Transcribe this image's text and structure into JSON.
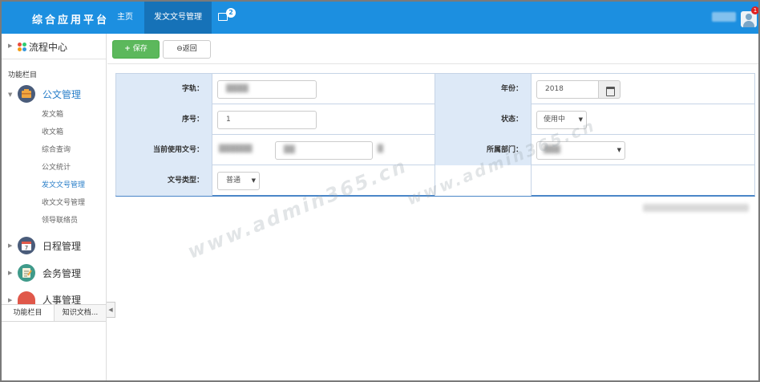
{
  "header": {
    "brand": "综合应用平台",
    "nav": {
      "home": "主页",
      "active_tab": "发文文号管理"
    },
    "message_count": "2",
    "notification_count": "1"
  },
  "sidebar": {
    "top_label": "流程中心",
    "section_title": "功能栏目",
    "groups": [
      {
        "label": "公文管理",
        "icon": "document-mgmt-icon"
      },
      {
        "label": "日程管理",
        "icon": "calendar-icon"
      },
      {
        "label": "会务管理",
        "icon": "meeting-icon"
      },
      {
        "label": "人事管理",
        "icon": "hr-icon"
      }
    ],
    "sub_items": [
      "发文箱",
      "收文箱",
      "综合查询",
      "公文统计",
      "发文文号管理",
      "收文文号管理",
      "领导联络员"
    ],
    "active_sub_index": 4,
    "tabs": [
      "功能栏目",
      "知识文档..."
    ],
    "calendar_day": "7"
  },
  "toolbar": {
    "save_label": "保存",
    "back_label": "返回",
    "save_icon": "+",
    "back_icon": "⊖"
  },
  "form": {
    "zigui_label": "字轨：",
    "year_label": "年份：",
    "year_value": "2018",
    "seq_label": "序号：",
    "seq_value": "1",
    "status_label": "状态：",
    "status_value": "使用中",
    "current_no_label": "当前使用文号：",
    "department_label": "所属部门：",
    "doctype_label": "文号类型：",
    "doctype_value": "普通"
  },
  "watermark": "www.admin365.cn",
  "colors": {
    "topbar": "#1c8fe0",
    "topbar_active": "#1672b8",
    "save_button": "#5cb85c",
    "label_bg": "#dde9f7",
    "active_link": "#2a7fc9"
  }
}
